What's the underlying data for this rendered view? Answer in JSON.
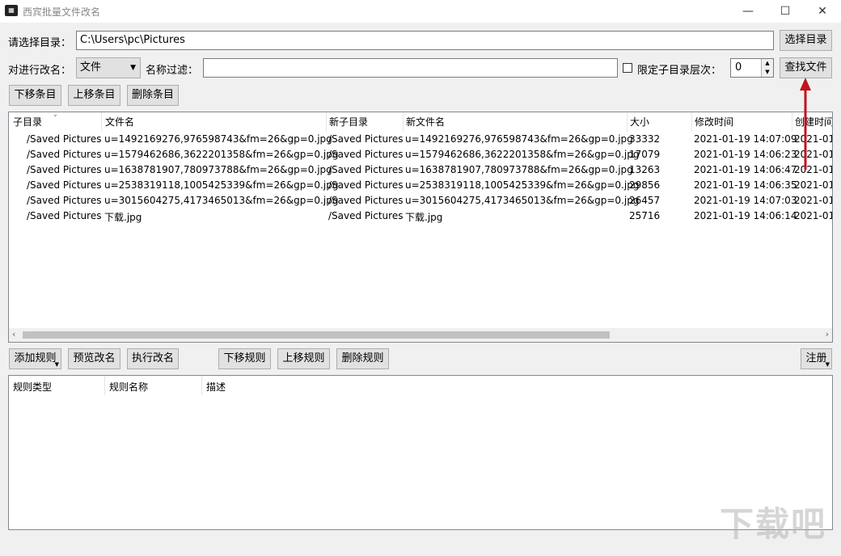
{
  "window": {
    "title": "西宾批量文件改名",
    "icon": "app-icon"
  },
  "dir_row": {
    "label": "请选择目录：",
    "path": "C:\\Users\\pc\\Pictures",
    "button": "选择目录"
  },
  "filter_row": {
    "rename_label": "对进行改名：",
    "rename_value": "文件",
    "filter_label": "名称过滤：",
    "filter_value": "",
    "limit_label": "限定子目录层次：",
    "limit_checked": false,
    "depth_value": "0",
    "find_button": "查找文件"
  },
  "item_buttons": {
    "move_down": "下移条目",
    "move_up": "上移条目",
    "delete": "删除条目"
  },
  "file_table": {
    "columns": [
      "子目录",
      "文件名",
      "新子目录",
      "新文件名",
      "大小",
      "修改时间",
      "创建时间"
    ],
    "rows": [
      [
        "/Saved Pictures",
        "u=1492169276,976598743&fm=26&gp=0.jpg",
        "/Saved Pictures",
        "u=1492169276,976598743&fm=26&gp=0.jpg",
        "33332",
        "2021-01-19 14:07:09",
        "2021-01"
      ],
      [
        "/Saved Pictures",
        "u=1579462686,3622201358&fm=26&gp=0.jpg",
        "/Saved Pictures",
        "u=1579462686,3622201358&fm=26&gp=0.jpg",
        "17079",
        "2021-01-19 14:06:23",
        "2021-01"
      ],
      [
        "/Saved Pictures",
        "u=1638781907,780973788&fm=26&gp=0.jpg",
        "/Saved Pictures",
        "u=1638781907,780973788&fm=26&gp=0.jpg",
        "13263",
        "2021-01-19 14:06:47",
        "2021-01"
      ],
      [
        "/Saved Pictures",
        "u=2538319118,1005425339&fm=26&gp=0.jpg",
        "/Saved Pictures",
        "u=2538319118,1005425339&fm=26&gp=0.jpg",
        "29856",
        "2021-01-19 14:06:35",
        "2021-01"
      ],
      [
        "/Saved Pictures",
        "u=3015604275,4173465013&fm=26&gp=0.jpg",
        "/Saved Pictures",
        "u=3015604275,4173465013&fm=26&gp=0.jpg",
        "26457",
        "2021-01-19 14:07:03",
        "2021-01"
      ],
      [
        "/Saved Pictures",
        "下载.jpg",
        "/Saved Pictures",
        "下载.jpg",
        "25716",
        "2021-01-19 14:06:14",
        "2021-01"
      ]
    ]
  },
  "rule_buttons": {
    "add": "添加规则",
    "preview": "预览改名",
    "execute": "执行改名",
    "move_down": "下移规则",
    "move_up": "上移规则",
    "delete": "删除规则",
    "register": "注册"
  },
  "rule_table": {
    "columns": [
      "规则类型",
      "规则名称",
      "描述"
    ]
  },
  "watermark": {
    "text": "下载吧",
    "url": "www.xiazaiba.com"
  },
  "colors": {
    "annotation_arrow": "#c0151b"
  }
}
